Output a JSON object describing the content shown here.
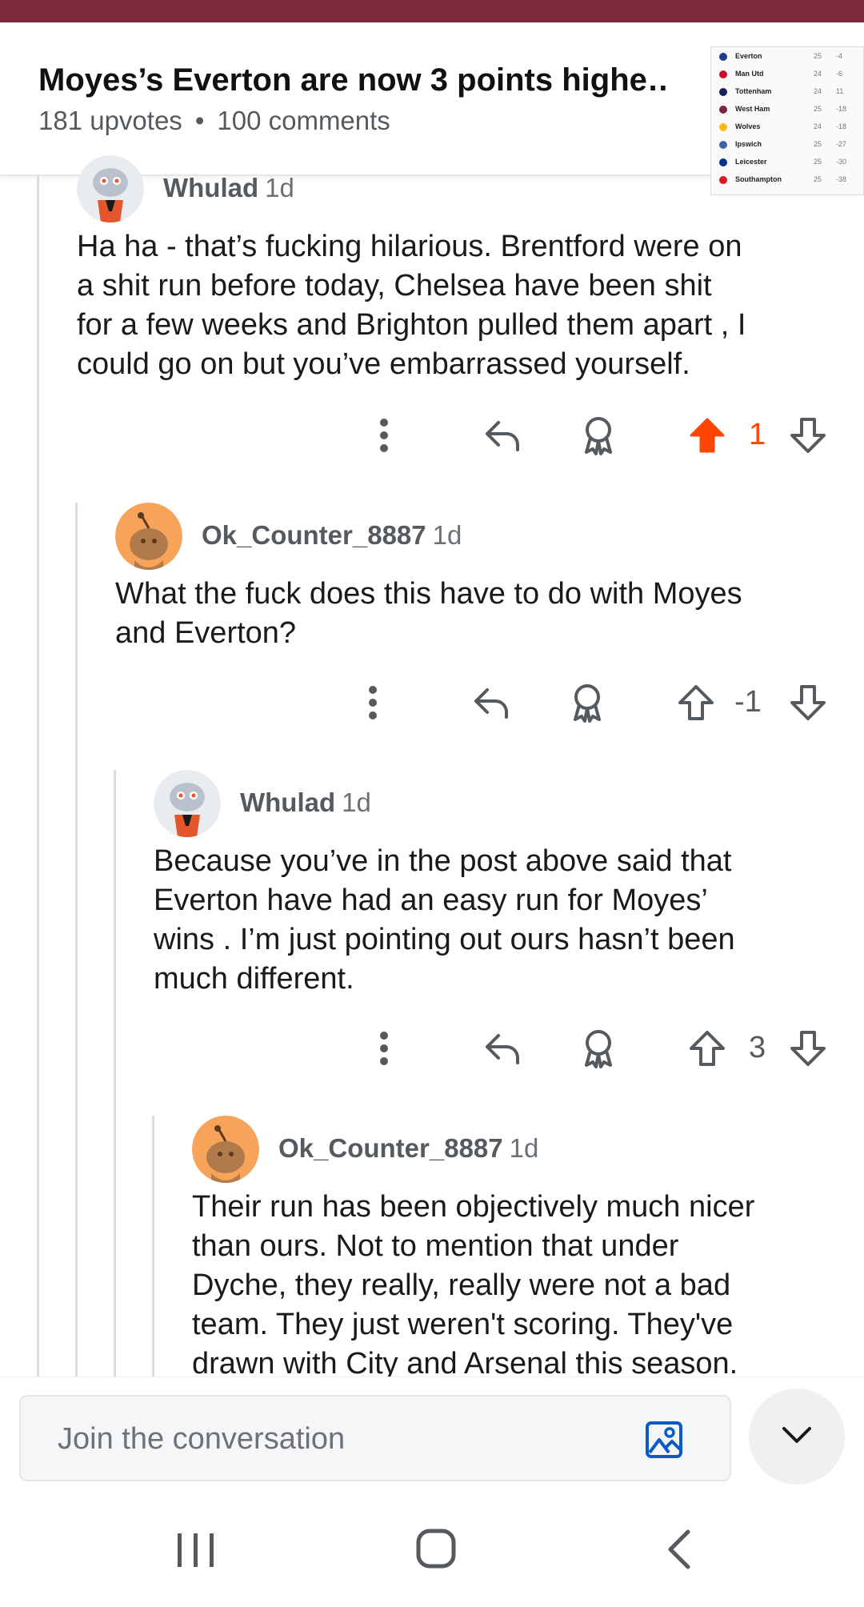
{
  "post": {
    "title": "Moyes’s Everton are now 3 points highe…",
    "upvotes": "181 upvotes",
    "separator": "•",
    "comments": "100 comments"
  },
  "thumbnail": {
    "rows": [
      {
        "team": "Everton",
        "p": "25",
        "gd": "-4",
        "color": "#1f3c8a"
      },
      {
        "team": "Man Utd",
        "p": "24",
        "gd": "-6",
        "color": "#c8102e"
      },
      {
        "team": "Tottenham",
        "p": "24",
        "gd": "11",
        "color": "#132257"
      },
      {
        "team": "West Ham",
        "p": "25",
        "gd": "-18",
        "color": "#7a263a"
      },
      {
        "team": "Wolves",
        "p": "24",
        "gd": "-18",
        "color": "#fdb913"
      },
      {
        "team": "Ipswich",
        "p": "25",
        "gd": "-27",
        "color": "#3a64a3"
      },
      {
        "team": "Leicester",
        "p": "25",
        "gd": "-30",
        "color": "#003090"
      },
      {
        "team": "Southampton",
        "p": "25",
        "gd": "-38",
        "color": "#d71920"
      }
    ]
  },
  "comments": [
    {
      "author": "Whulad",
      "age": "1d",
      "lines": [
        "Ha ha - that’s fucking hilarious. Brentford were on",
        "a shit run before today, Chelsea have been shit",
        "for a few weeks and Brighton pulled them apart , I",
        "could go on but you’ve embarrassed yourself."
      ],
      "score": "1",
      "upvoted": true
    },
    {
      "author": "Ok_Counter_8887",
      "age": "1d",
      "lines": [
        "What the fuck does this have to do with Moyes",
        "and Everton?"
      ],
      "score": "-1",
      "upvoted": false
    },
    {
      "author": "Whulad",
      "age": "1d",
      "lines": [
        "Because you’ve in the post above said that",
        "Everton have had an easy run for Moyes’",
        "wins . I’m just pointing out ours hasn’t been",
        "much different."
      ],
      "score": "3",
      "upvoted": false
    },
    {
      "author": "Ok_Counter_8887",
      "age": "1d",
      "lines": [
        "Their run has been objectively much nicer",
        "than ours. Not to mention that under",
        "Dyche, they really, really were not a bad",
        "team. They just weren't scoring. They've",
        "drawn with City and Arsenal this season."
      ],
      "score": "",
      "upvoted": false
    }
  ],
  "composer": {
    "placeholder": "Join the conversation"
  },
  "icons": {
    "more": "more-vertical-icon",
    "reply": "reply-icon",
    "award": "award-icon",
    "upvote": "upvote-arrow-icon",
    "downvote": "downvote-arrow-icon",
    "image": "image-icon",
    "collapse": "chevron-down-icon"
  },
  "colors": {
    "upvote": "#ff4500",
    "header": "#7c2a3b",
    "avatar_orange": "#f8a35a"
  }
}
